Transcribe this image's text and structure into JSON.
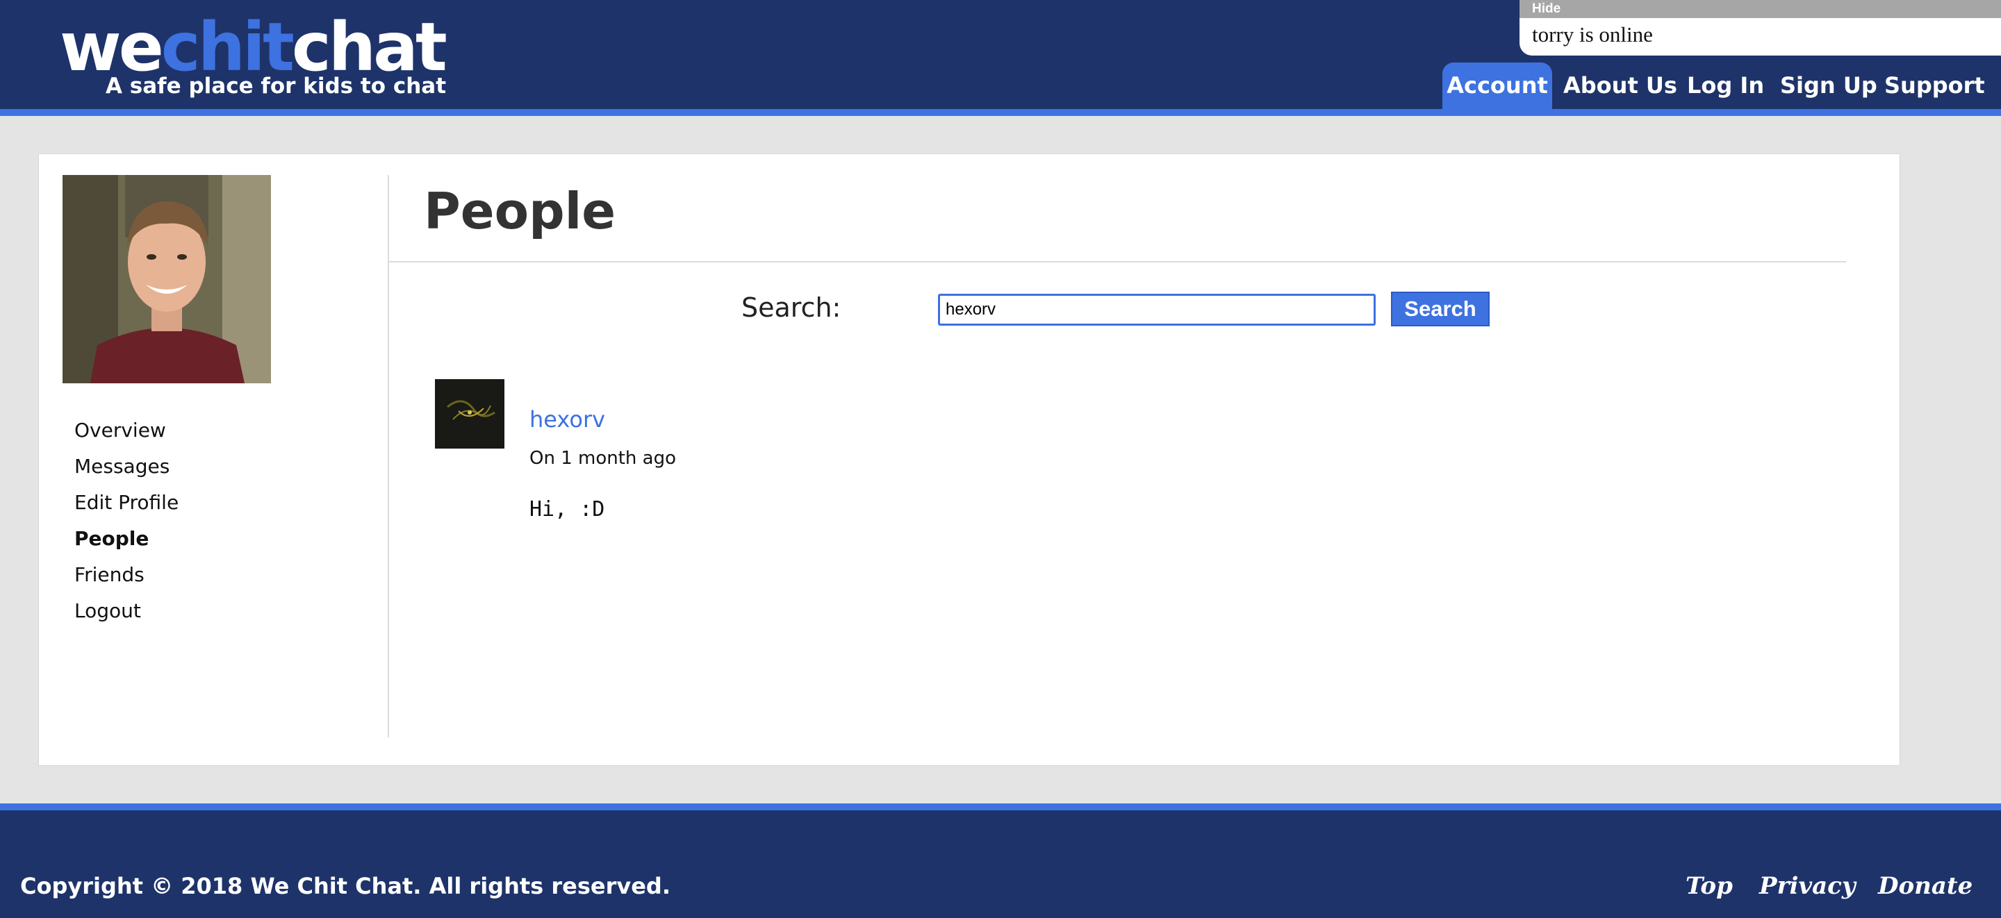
{
  "header": {
    "logo": {
      "part1": "we",
      "part2": "chit",
      "part3": "chat"
    },
    "tagline": "A safe place for kids to chat",
    "online_panel": {
      "hide_label": "Hide",
      "status_text": "torry is online"
    },
    "nav": [
      {
        "label": "Account",
        "active": true
      },
      {
        "label": "About Us",
        "active": false
      },
      {
        "label": "Log In",
        "active": false
      },
      {
        "label": "Sign Up",
        "active": false
      },
      {
        "label": "Support",
        "active": false
      }
    ]
  },
  "sidebar": {
    "items": [
      {
        "label": "Overview"
      },
      {
        "label": "Messages"
      },
      {
        "label": "Edit Profile"
      },
      {
        "label": "People",
        "current": true
      },
      {
        "label": "Friends"
      },
      {
        "label": "Logout"
      }
    ]
  },
  "main": {
    "title": "People",
    "search": {
      "label": "Search:",
      "value": "hexorv",
      "button_label": "Search"
    },
    "results": [
      {
        "name": "hexorv",
        "time": "On 1 month ago",
        "message": "Hi, :D"
      }
    ]
  },
  "footer": {
    "copyright": "Copyright © 2018 We Chit Chat. All rights reserved.",
    "links": [
      "Top",
      "Privacy",
      "Donate"
    ]
  },
  "colors": {
    "brand_navy": "#1e3369",
    "accent_blue": "#3d72e0",
    "page_background": "#e4e4e4"
  }
}
